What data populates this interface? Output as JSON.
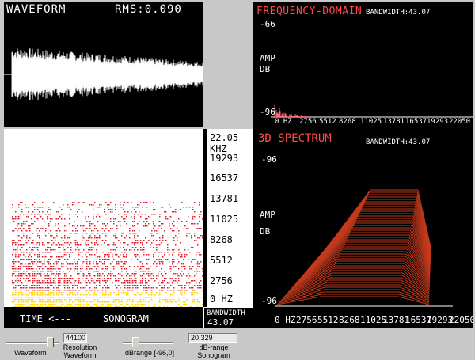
{
  "waveform": {
    "title": "WAVEFORM",
    "rms_label": "RMS:0.090"
  },
  "frequency_domain": {
    "title": "FREQUENCY-DOMAIN",
    "bandwidth_label": "BANDWIDTH:43.07",
    "db_top": "-66",
    "db_bottom": "-96",
    "amp_label": "AMP",
    "db_label": "DB",
    "x_ticks": [
      "0 HZ",
      "2756",
      "5512",
      "8268",
      "11025",
      "13781",
      "16537",
      "19293",
      "22050"
    ]
  },
  "spectrum_3d": {
    "title": "3D SPECTRUM",
    "bandwidth_label": "BANDWIDTH:43.07",
    "db_top": "-96",
    "db_bottom": "-96",
    "amp_label": "AMP",
    "db_label": "DB",
    "x_ticks": [
      "0 HZ",
      "2756",
      "5512",
      "8268",
      "11025",
      "13781",
      "16537",
      "19293",
      "22050"
    ]
  },
  "sonogram": {
    "time_label": "TIME <---",
    "title": "SONOGRAM",
    "freq_ticks": [
      "22.05 KHZ",
      "19293",
      "16537",
      "13781",
      "11025",
      "8268",
      "5512",
      "2756",
      "0 HZ"
    ],
    "bandwidth_title": "BANDWIDTH",
    "bandwidth_value": "43.07"
  },
  "controls": {
    "waveform_label": "Waveform",
    "resolution_value": "44100",
    "resolution_label_line1": "Resolution",
    "resolution_label_line2": "Waveform",
    "dbrange_slider_label": "dBrange [-96,0]",
    "dbrange_value": "20.329",
    "dbrange_label_line1": "dB-range",
    "dbrange_label_line2": "Sonogram"
  },
  "colors": {
    "panel_bg": "#000000",
    "window_bg": "#c8c8c8",
    "title_red": "#ff4a4a",
    "spectrum_red": "#c43a1c",
    "sonogram_red": "#e0202a",
    "sonogram_yellow": "#ffd400"
  }
}
